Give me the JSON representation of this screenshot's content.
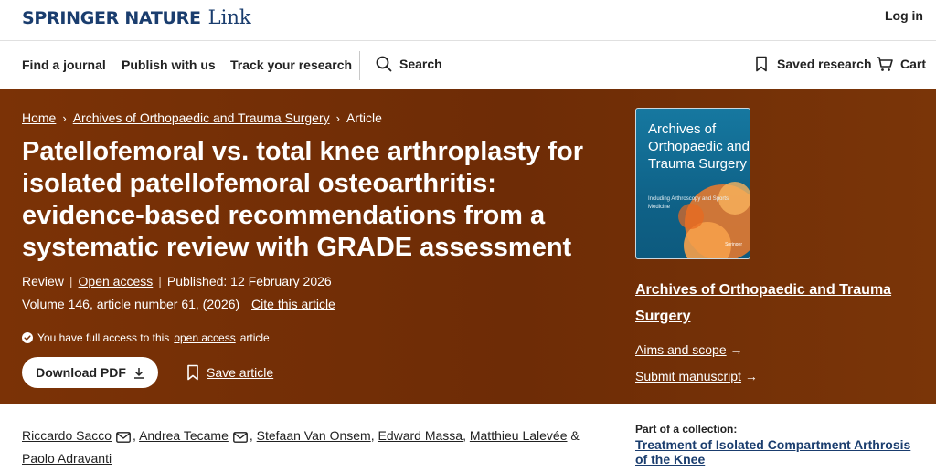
{
  "header": {
    "brand": "SPRINGER NATURE",
    "brand_suffix": "Link",
    "login": "Log in"
  },
  "nav": {
    "find_journal": "Find a journal",
    "publish": "Publish with us",
    "track": "Track your research",
    "search": "Search",
    "saved": "Saved research",
    "cart": "Cart"
  },
  "breadcrumb": {
    "home": "Home",
    "journal": "Archives of Orthopaedic and Trauma Surgery",
    "current": "Article"
  },
  "article": {
    "title": "Patellofemoral vs. total knee arthroplasty for isolated patellofemoral osteoarthritis: evidence-based recommendations from a systematic review with GRADE assessment",
    "type": "Review",
    "access": "Open access",
    "published": "Published: 12 February 2026",
    "volume": "Volume 146, article number 61, (2026)",
    "cite": "Cite this article",
    "access_note_pre": "You have full access to this",
    "access_note_link": "open access",
    "access_note_post": "article",
    "download": "Download PDF",
    "save": "Save article"
  },
  "journal": {
    "cover_title": "Archives of Orthopaedic and Trauma Surgery",
    "cover_subtitle": "Including Arthroscopy and Sports Medicine",
    "cover_publisher": "Springer",
    "name": "Archives of Orthopaedic and Trauma Surgery",
    "aims": "Aims and scope",
    "submit": "Submit manuscript"
  },
  "authors": [
    "Riccardo Sacco",
    "Andrea Tecame",
    "Stefaan Van Onsem",
    "Edward Massa",
    "Matthieu Lalevée",
    "Paolo Adravanti"
  ],
  "collection": {
    "label": "Part of a collection:",
    "name": "Treatment of Isolated Compartment Arthrosis of the Knee"
  },
  "colors": {
    "hero": "#7b3206",
    "brand": "#1a3d6e",
    "cover": "#1678a0"
  }
}
